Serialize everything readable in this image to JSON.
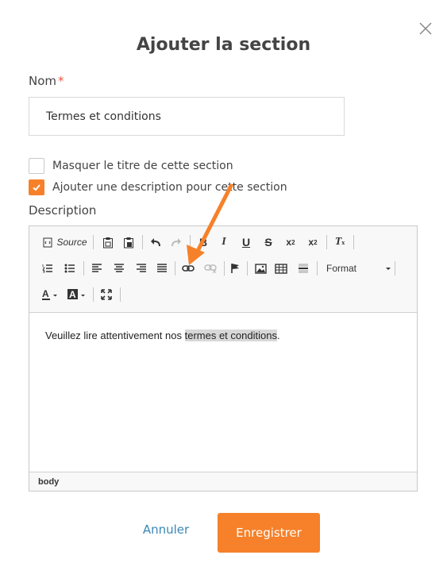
{
  "dialog": {
    "title": "Ajouter la section",
    "close_icon": "close-icon"
  },
  "form": {
    "name_label": "Nom",
    "name_required_mark": "*",
    "name_value": "Termes et conditions",
    "hide_title_label": "Masquer le titre de cette section",
    "hide_title_checked": false,
    "add_description_label": "Ajouter une description pour cette section",
    "add_description_checked": true,
    "description_label": "Description"
  },
  "editor": {
    "toolbar": {
      "source_label": "Source",
      "format_label": "Format",
      "icons": [
        "source-icon",
        "paste-icon",
        "paste-word-icon",
        "undo-icon",
        "redo-icon",
        "bold-icon",
        "italic-icon",
        "underline-icon",
        "strikethrough-icon",
        "subscript-icon",
        "superscript-icon",
        "remove-format-icon",
        "numbered-list-icon",
        "bulleted-list-icon",
        "align-left-icon",
        "align-center-icon",
        "align-right-icon",
        "justify-icon",
        "link-icon",
        "unlink-icon",
        "anchor-icon",
        "image-icon",
        "table-icon",
        "horizontal-rule-icon",
        "format-dropdown",
        "text-color-icon",
        "background-color-icon",
        "maximize-icon"
      ]
    },
    "content_before": "Veuillez lire attentivement nos ",
    "content_link": "termes et conditions",
    "content_after": ".",
    "status_path": "body"
  },
  "actions": {
    "cancel_label": "Annuler",
    "save_label": "Enregistrer"
  },
  "colors": {
    "accent": "#f6812a",
    "link": "#3b87b6",
    "required": "#e8553e"
  }
}
